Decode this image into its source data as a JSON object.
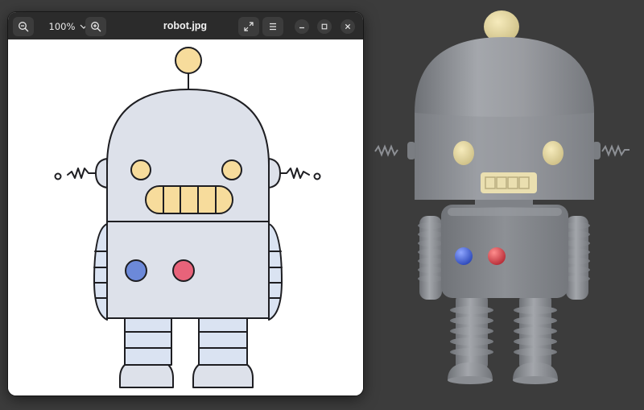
{
  "viewer": {
    "title": "robot.jpg",
    "zoom": "100%",
    "icons": {
      "zoom_out": "zoom-out-icon",
      "zoom_in": "zoom-in-icon",
      "fullscreen": "fullscreen-icon",
      "menu": "hamburger-menu-icon",
      "minimize": "minimize-icon",
      "maximize": "maximize-icon",
      "close": "close-icon"
    }
  },
  "colors": {
    "desktop": "#3c3c3c",
    "headerbar": "#2b2b2b",
    "robot_body": "#dde1ea",
    "robot_limbs": "#dae3f2",
    "accent_yellow": "#f7dc9c",
    "button_blue": "#6c89d9",
    "button_red": "#e8637a",
    "render_grey": "#8b8e93"
  }
}
